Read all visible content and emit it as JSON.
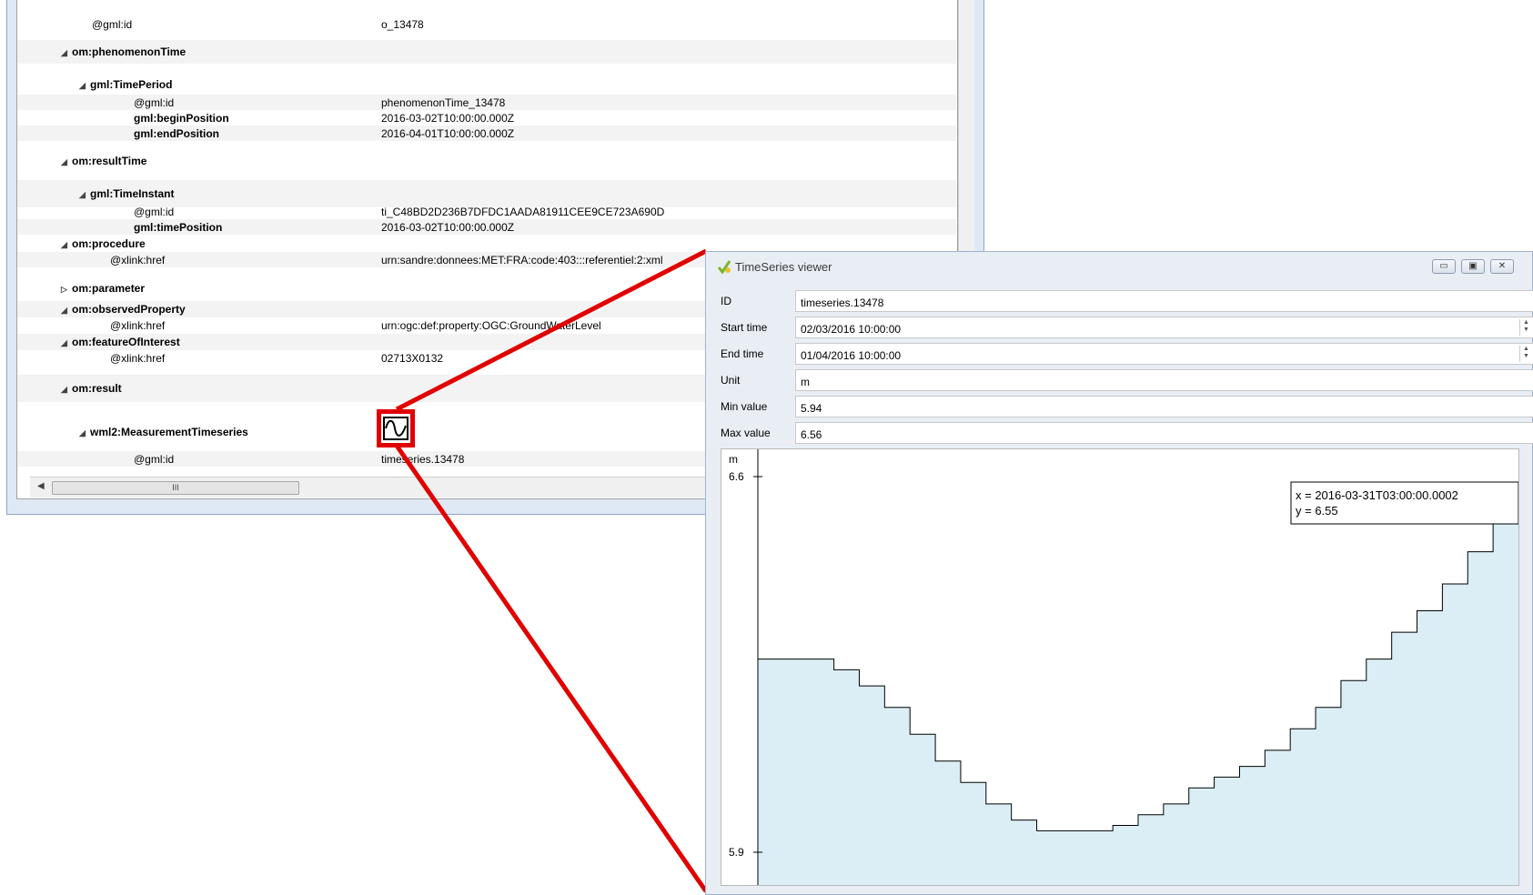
{
  "tree": {
    "rows": [
      {
        "key": "@gml:id",
        "value": "o_13478",
        "bold": false,
        "indent": 1,
        "tri": ""
      },
      {
        "key": "om:phenomenonTime",
        "value": "",
        "bold": true,
        "indent": 1,
        "tri": "◢"
      },
      {
        "key": "gml:TimePeriod",
        "value": "",
        "bold": true,
        "indent": 2,
        "tri": "◢"
      },
      {
        "key": "@gml:id",
        "value": "phenomenonTime_13478",
        "bold": false,
        "indent": 3,
        "tri": ""
      },
      {
        "key": "gml:beginPosition",
        "value": "2016-03-02T10:00:00.000Z",
        "bold": true,
        "indent": 3,
        "tri": ""
      },
      {
        "key": "gml:endPosition",
        "value": "2016-04-01T10:00:00.000Z",
        "bold": true,
        "indent": 3,
        "tri": ""
      },
      {
        "key": "om:resultTime",
        "value": "",
        "bold": true,
        "indent": 1,
        "tri": "◢"
      },
      {
        "key": "gml:TimeInstant",
        "value": "",
        "bold": true,
        "indent": 2,
        "tri": "◢"
      },
      {
        "key": "@gml:id",
        "value": "ti_C48BD2D236B7DFDC1AADA81911CEE9CE723A690D",
        "bold": false,
        "indent": 3,
        "tri": ""
      },
      {
        "key": "gml:timePosition",
        "value": "2016-03-02T10:00:00.000Z",
        "bold": true,
        "indent": 3,
        "tri": ""
      },
      {
        "key": "om:procedure",
        "value": "",
        "bold": true,
        "indent": 1,
        "tri": "◢"
      },
      {
        "key": "@xlink:href",
        "value": "urn:sandre:donnees:MET:FRA:code:403:::referentiel:2:xml",
        "bold": false,
        "indent": 2,
        "tri": ""
      },
      {
        "key": "om:parameter",
        "value": "",
        "bold": true,
        "indent": 1,
        "tri": "▷"
      },
      {
        "key": "om:observedProperty",
        "value": "",
        "bold": true,
        "indent": 1,
        "tri": "◢"
      },
      {
        "key": "@xlink:href",
        "value": "urn:ogc:def:property:OGC:GroundWaterLevel",
        "bold": false,
        "indent": 2,
        "tri": ""
      },
      {
        "key": "om:featureOfInterest",
        "value": "",
        "bold": true,
        "indent": 1,
        "tri": "◢"
      },
      {
        "key": "@xlink:href",
        "value": "02713X0132",
        "bold": false,
        "indent": 2,
        "tri": ""
      },
      {
        "key": "om:result",
        "value": "",
        "bold": true,
        "indent": 1,
        "tri": "◢"
      },
      {
        "key": "wml2:MeasurementTimeseries",
        "value": "",
        "bold": true,
        "indent": 2,
        "tri": "◢"
      },
      {
        "key": "@gml:id",
        "value": "timeseries.13478",
        "bold": false,
        "indent": 3,
        "tri": ""
      }
    ],
    "scroll_thumb_label": "III"
  },
  "viewer": {
    "title": "TimeSeries viewer",
    "fields": [
      {
        "label": "ID",
        "value": "timeseries.13478",
        "spin": false
      },
      {
        "label": "Start time",
        "value": "02/03/2016 10:00:00",
        "spin": true
      },
      {
        "label": "End time",
        "value": "01/04/2016 10:00:00",
        "spin": true
      },
      {
        "label": "Unit",
        "value": "m",
        "spin": false
      },
      {
        "label": "Min value",
        "value": "5.94",
        "spin": false
      },
      {
        "label": "Max value",
        "value": "6.56",
        "spin": false
      }
    ],
    "buttons": {
      "minimize": "▭",
      "maximize": "▣",
      "close": "✕"
    }
  },
  "chart_data": {
    "type": "area",
    "ylabel": "m",
    "ylim": [
      5.9,
      6.6
    ],
    "yticks": [
      6.6,
      5.9
    ],
    "x": [
      "2016-03-02",
      "2016-03-03",
      "2016-03-04",
      "2016-03-05",
      "2016-03-06",
      "2016-03-07",
      "2016-03-08",
      "2016-03-09",
      "2016-03-10",
      "2016-03-11",
      "2016-03-12",
      "2016-03-13",
      "2016-03-14",
      "2016-03-15",
      "2016-03-16",
      "2016-03-17",
      "2016-03-18",
      "2016-03-19",
      "2016-03-20",
      "2016-03-21",
      "2016-03-22",
      "2016-03-23",
      "2016-03-24",
      "2016-03-25",
      "2016-03-26",
      "2016-03-27",
      "2016-03-28",
      "2016-03-29",
      "2016-03-30",
      "2016-03-31",
      "2016-04-01"
    ],
    "values": [
      6.26,
      6.26,
      6.26,
      6.24,
      6.21,
      6.17,
      6.12,
      6.07,
      6.03,
      5.99,
      5.96,
      5.94,
      5.94,
      5.94,
      5.95,
      5.97,
      5.99,
      6.02,
      6.04,
      6.06,
      6.09,
      6.13,
      6.17,
      6.22,
      6.26,
      6.31,
      6.35,
      6.4,
      6.46,
      6.55,
      6.56
    ],
    "tooltip": {
      "x": "x = 2016-03-31T03:00:00.0002",
      "y": "y = 6.55"
    }
  },
  "colors": {
    "accent": "#e00000",
    "fill": "#dbeef5",
    "marker": "#1f3bb3"
  }
}
